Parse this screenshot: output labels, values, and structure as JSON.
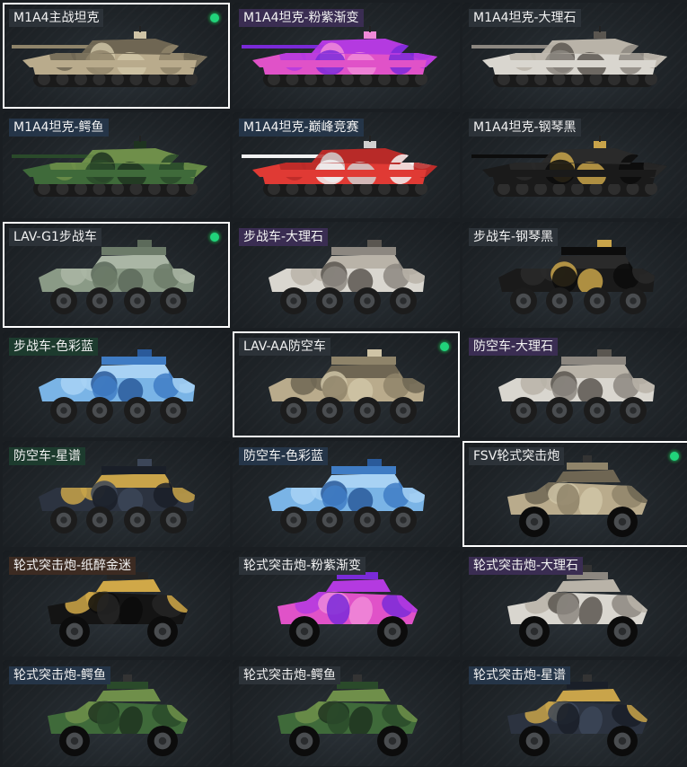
{
  "palette": {
    "label_tint_green": "#1d3b2e",
    "label_tint_purple": "#3a2d52",
    "label_tint_blue": "#253548",
    "label_tint_brown": "#3c2b22",
    "label_tint_gray": "#2c3238",
    "equipped_dot": "#21d37a"
  },
  "cards": [
    {
      "label": "M1A4主战坦克",
      "kind": "tank",
      "skin": "desert",
      "tint": "gray",
      "equipped": true
    },
    {
      "label": "M1A4坦克-粉紫渐变",
      "kind": "tank",
      "skin": "pinkpurple",
      "tint": "purple",
      "equipped": false
    },
    {
      "label": "M1A4坦克-大理石",
      "kind": "tank",
      "skin": "marble",
      "tint": "gray",
      "equipped": false
    },
    {
      "label": "M1A4坦克-鳄鱼",
      "kind": "tank",
      "skin": "croc",
      "tint": "blue",
      "equipped": false
    },
    {
      "label": "M1A4坦克-巅峰竞赛",
      "kind": "tank",
      "skin": "race",
      "tint": "blue",
      "equipped": false
    },
    {
      "label": "M1A4坦克-钢琴黑",
      "kind": "tank",
      "skin": "black",
      "tint": "gray",
      "equipped": false
    },
    {
      "label": "LAV-G1步战车",
      "kind": "lav",
      "skin": "camo",
      "tint": "gray",
      "equipped": true
    },
    {
      "label": "步战车-大理石",
      "kind": "lav",
      "skin": "marble",
      "tint": "purple",
      "equipped": false
    },
    {
      "label": "步战车-钢琴黑",
      "kind": "lav",
      "skin": "black",
      "tint": "gray",
      "equipped": false
    },
    {
      "label": "步战车-色彩蓝",
      "kind": "lav",
      "skin": "blue",
      "tint": "green",
      "equipped": false
    },
    {
      "label": "LAV-AA防空车",
      "kind": "lav",
      "skin": "desert",
      "tint": "gray",
      "equipped": true
    },
    {
      "label": "防空车-大理石",
      "kind": "lav",
      "skin": "marble",
      "tint": "purple",
      "equipped": false
    },
    {
      "label": "防空车-星谱",
      "kind": "lav",
      "skin": "star",
      "tint": "green",
      "equipped": false
    },
    {
      "label": "防空车-色彩蓝",
      "kind": "lav",
      "skin": "blue",
      "tint": "blue",
      "equipped": false
    },
    {
      "label": "FSV轮式突击炮",
      "kind": "fsv",
      "skin": "desert",
      "tint": "gray",
      "equipped": true
    },
    {
      "label": "轮式突击炮-纸醉金迷",
      "kind": "fsv",
      "skin": "goldblack",
      "tint": "brown",
      "equipped": false
    },
    {
      "label": "轮式突击炮-粉紫渐变",
      "kind": "fsv",
      "skin": "pinkpurple",
      "tint": "gray",
      "equipped": false
    },
    {
      "label": "轮式突击炮-大理石",
      "kind": "fsv",
      "skin": "marble",
      "tint": "purple",
      "equipped": false
    },
    {
      "label": "轮式突击炮-鳄鱼",
      "kind": "fsv",
      "skin": "croc",
      "tint": "blue",
      "equipped": false
    },
    {
      "label": "轮式突击炮-鳄鱼",
      "kind": "fsv",
      "skin": "croc",
      "tint": "gray",
      "equipped": false
    },
    {
      "label": "轮式突击炮-星谱",
      "kind": "fsv",
      "skin": "star",
      "tint": "blue",
      "equipped": false
    }
  ]
}
